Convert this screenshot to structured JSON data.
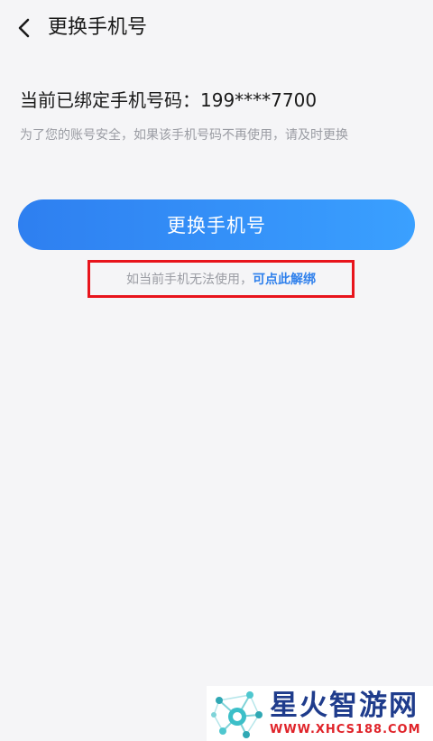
{
  "header": {
    "title": "更换手机号"
  },
  "account": {
    "bound_label": "当前已绑定手机号码：",
    "phone": "199****7700",
    "hint": "为了您的账号安全，如果该手机号码不再使用，请及时更换"
  },
  "actions": {
    "change_button_label": "更换手机号",
    "unbind_prefix": "如当前手机无法使用，",
    "unbind_link": "可点此解绑"
  },
  "watermark": {
    "brand": "星火智游网",
    "url": "WWW.XHCS188.COM"
  },
  "colors": {
    "accent": "#2f80ec",
    "highlight_box": "#e8141c",
    "background": "#f5f5f7"
  }
}
